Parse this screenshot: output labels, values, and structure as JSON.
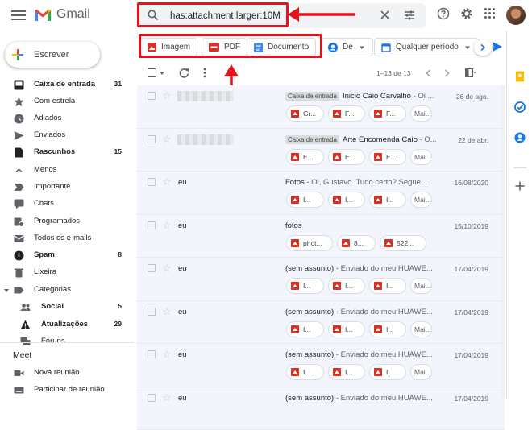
{
  "app": {
    "title": "Gmail"
  },
  "search": {
    "query": "has:attachment larger:10M"
  },
  "compose": {
    "label": "Escrever"
  },
  "nav": [
    {
      "label": "Caixa de entrada",
      "count": "31",
      "bold": true,
      "icon": "inbox-icon"
    },
    {
      "label": "Com estrela",
      "count": "",
      "bold": false,
      "icon": "star-icon"
    },
    {
      "label": "Adiados",
      "count": "",
      "bold": false,
      "icon": "clock-icon"
    },
    {
      "label": "Enviados",
      "count": "",
      "bold": false,
      "icon": "send-icon"
    },
    {
      "label": "Rascunhos",
      "count": "15",
      "bold": true,
      "icon": "draft-icon"
    },
    {
      "label": "Menos",
      "count": "",
      "bold": false,
      "icon": "chevron-up-icon"
    },
    {
      "label": "Importante",
      "count": "",
      "bold": false,
      "icon": "important-icon"
    },
    {
      "label": "Chats",
      "count": "",
      "bold": false,
      "icon": "chat-icon"
    },
    {
      "label": "Programados",
      "count": "",
      "bold": false,
      "icon": "scheduled-icon"
    },
    {
      "label": "Todos os e-mails",
      "count": "",
      "bold": false,
      "icon": "mail-icon"
    },
    {
      "label": "Spam",
      "count": "8",
      "bold": true,
      "icon": "spam-icon"
    },
    {
      "label": "Lixeira",
      "count": "",
      "bold": false,
      "icon": "trash-icon"
    },
    {
      "label": "Categorias",
      "count": "",
      "bold": false,
      "icon": "label-icon"
    },
    {
      "label": "Social",
      "count": "5",
      "bold": true,
      "icon": "people-icon"
    },
    {
      "label": "Atualizações",
      "count": "29",
      "bold": true,
      "icon": "info-icon"
    },
    {
      "label": "Fóruns",
      "count": "",
      "bold": false,
      "icon": "forum-icon"
    }
  ],
  "meet": {
    "title": "Meet",
    "items": [
      {
        "label": "Nova reunião"
      },
      {
        "label": "Participar de reunião"
      }
    ]
  },
  "filters": {
    "image": "Imagem",
    "pdf": "PDF",
    "doc": "Documento",
    "from": "De",
    "period": "Qualquer período"
  },
  "toolbar": {
    "pagination": "1–13 de 13"
  },
  "emails": [
    {
      "sender": "",
      "blurred": true,
      "label": "Caixa de entrada",
      "subject": "Inicio Caio Carvalho",
      "snippet": " - Oi ...",
      "date": "26 de ago.",
      "attachments": [
        "Gr...",
        "F...",
        "F..."
      ],
      "more": "Mai..."
    },
    {
      "sender": "",
      "blurred": true,
      "label": "Caixa de entrada",
      "subject": "Arte Encomenda Caio",
      "snippet": " - O...",
      "date": "22 de abr.",
      "attachments": [
        "E...",
        "E...",
        "E..."
      ],
      "more": "Mai..."
    },
    {
      "sender": "eu",
      "blurred": false,
      "label": "",
      "subject": "Fotos",
      "snippet": " - Oi, Gustavo. Tudo certo? Segue...",
      "date": "16/08/2020",
      "attachments": [
        "I...",
        "I...",
        "I..."
      ],
      "more": "Mai..."
    },
    {
      "sender": "eu",
      "blurred": false,
      "label": "",
      "subject": "fotos",
      "snippet": "",
      "date": "15/10/2019",
      "attachments": [
        "phot...",
        "8...",
        "522..."
      ],
      "more": ""
    },
    {
      "sender": "eu",
      "blurred": false,
      "label": "",
      "subject": "(sem assunto)",
      "snippet": " - Enviado do meu HUAWE...",
      "date": "17/04/2019",
      "attachments": [
        "I...",
        "I...",
        "I..."
      ],
      "more": "Mai..."
    },
    {
      "sender": "eu",
      "blurred": false,
      "label": "",
      "subject": "(sem assunto)",
      "snippet": " - Enviado do meu HUAWE...",
      "date": "17/04/2019",
      "attachments": [
        "I...",
        "I...",
        "I..."
      ],
      "more": "Mai..."
    },
    {
      "sender": "eu",
      "blurred": false,
      "label": "",
      "subject": "(sem assunto)",
      "snippet": " - Enviado do meu HUAWE...",
      "date": "17/04/2019",
      "attachments": [
        "I...",
        "I...",
        "I..."
      ],
      "more": "Mai..."
    },
    {
      "sender": "eu",
      "blurred": false,
      "label": "",
      "subject": "(sem assunto)",
      "snippet": " - Enviado do meu HUAWE...",
      "date": "17/04/2019",
      "attachments": [],
      "more": ""
    }
  ],
  "colors": {
    "accent_red": "#e3121b",
    "gmail_red": "#ea4335",
    "doc_blue": "#4285f4"
  }
}
